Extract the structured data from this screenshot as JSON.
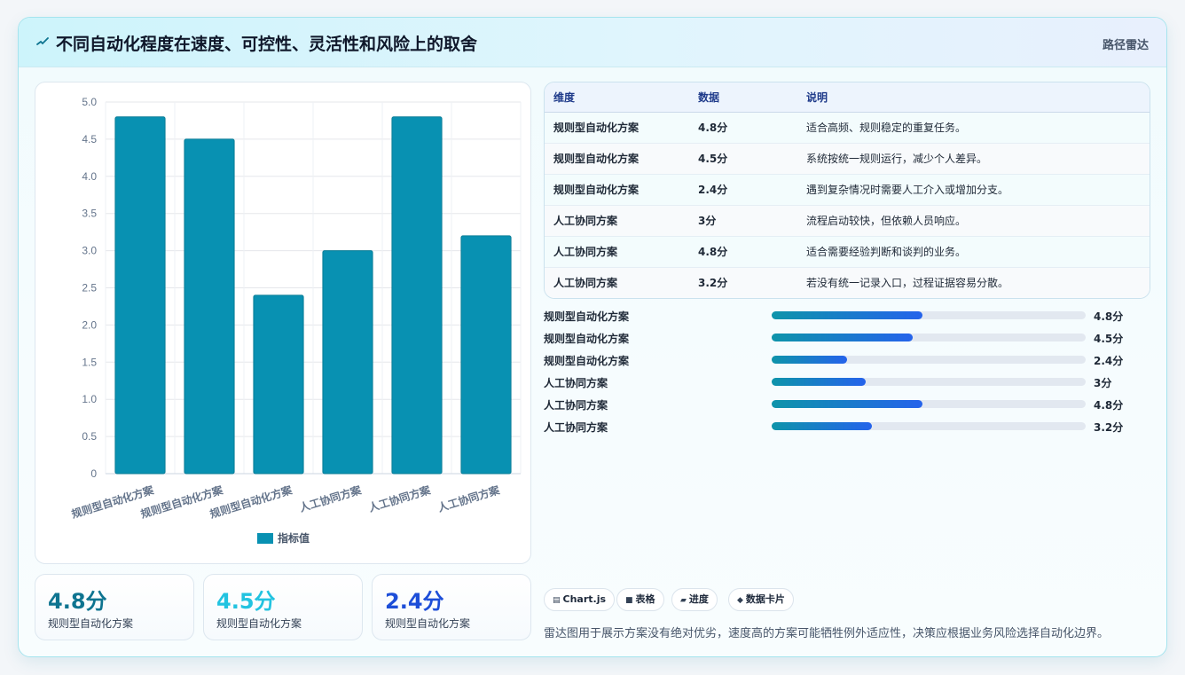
{
  "header": {
    "title": "不同自动化程度在速度、可控性、灵活性和风险上的取舍",
    "tag": "路径雷达",
    "logo_icon": "pulse-icon"
  },
  "chart_data": {
    "type": "bar",
    "categories": [
      "规则型自动化方案",
      "规则型自动化方案",
      "规则型自动化方案",
      "人工协同方案",
      "人工协同方案",
      "人工协同方案"
    ],
    "series": [
      {
        "name": "指标值",
        "values": [
          4.8,
          4.5,
          2.4,
          3,
          4.8,
          3.2
        ]
      }
    ],
    "yticks": [
      "0",
      "0.5",
      "1.0",
      "1.5",
      "2.0",
      "2.5",
      "3.0",
      "3.5",
      "4.0",
      "4.5",
      "5.0"
    ],
    "ylim": [
      0,
      5
    ],
    "grid": true,
    "legend": "bottom",
    "color": "#0891b2"
  },
  "kpis": [
    {
      "value": "4.8分",
      "label": "规则型自动化方案",
      "color": "#0e7490"
    },
    {
      "value": "4.5分",
      "label": "规则型自动化方案",
      "color": "#22c3e0"
    },
    {
      "value": "2.4分",
      "label": "规则型自动化方案",
      "color": "#1d4ed8"
    }
  ],
  "table": {
    "headers": [
      "维度",
      "数据",
      "说明"
    ],
    "rows": [
      [
        "规则型自动化方案",
        "4.8分",
        "适合高频、规则稳定的重复任务。"
      ],
      [
        "规则型自动化方案",
        "4.5分",
        "系统按统一规则运行，减少个人差异。"
      ],
      [
        "规则型自动化方案",
        "2.4分",
        "遇到复杂情况时需要人工介入或增加分支。"
      ],
      [
        "人工协同方案",
        "3分",
        "流程启动较快，但依赖人员响应。"
      ],
      [
        "人工协同方案",
        "4.8分",
        "适合需要经验判断和谈判的业务。"
      ],
      [
        "人工协同方案",
        "3.2分",
        "若没有统一记录入口，过程证据容易分散。"
      ]
    ]
  },
  "progress": [
    {
      "label": "规则型自动化方案",
      "value": 4.8,
      "text": "4.8分"
    },
    {
      "label": "规则型自动化方案",
      "value": 4.5,
      "text": "4.5分"
    },
    {
      "label": "规则型自动化方案",
      "value": 2.4,
      "text": "2.4分"
    },
    {
      "label": "人工协同方案",
      "value": 3,
      "text": "3分"
    },
    {
      "label": "人工协同方案",
      "value": 4.8,
      "text": "4.8分"
    },
    {
      "label": "人工协同方案",
      "value": 3.2,
      "text": "3.2分"
    }
  ],
  "progress_max": 10,
  "chips": [
    {
      "icon": "▤",
      "icon_name": "chart-icon",
      "label": "Chart.js"
    },
    {
      "icon": "■",
      "icon_name": "table-icon",
      "label": "表格"
    },
    {
      "icon": "▰",
      "icon_name": "progress-icon",
      "label": "进度"
    },
    {
      "icon": "◆",
      "icon_name": "card-icon",
      "label": "数据卡片"
    }
  ],
  "note": "雷达图用于展示方案没有绝对优劣，速度高的方案可能牺牲例外适应性，决策应根据业务风险选择自动化边界。"
}
